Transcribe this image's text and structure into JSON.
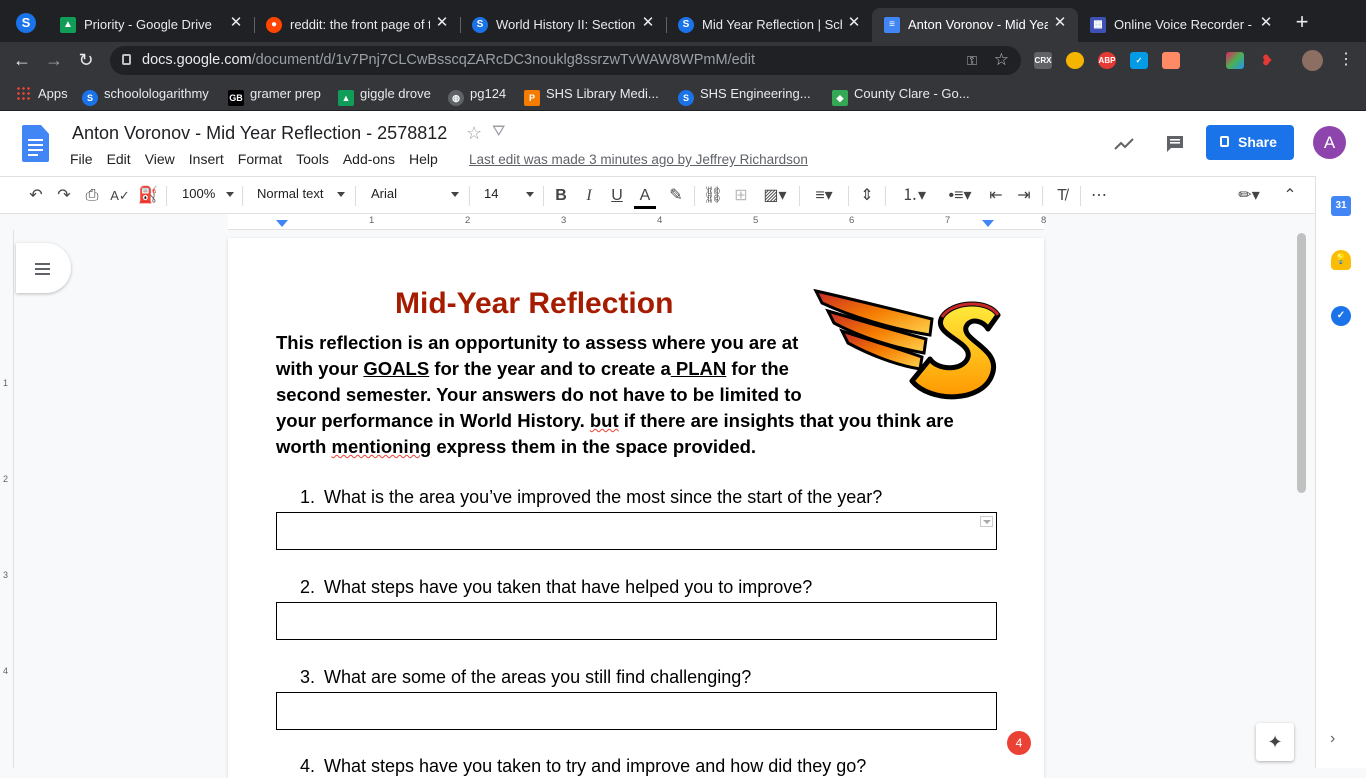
{
  "browser": {
    "tabs": [
      {
        "title": "Priority - Google Drive",
        "icon": "google-drive-icon",
        "active": false
      },
      {
        "title": "reddit: the front page of t",
        "icon": "reddit-icon",
        "active": false
      },
      {
        "title": "World History II: Section",
        "icon": "schoology-icon",
        "active": false
      },
      {
        "title": "Mid Year Reflection | Sch",
        "icon": "schoology-icon",
        "active": false
      },
      {
        "title": "Anton Voronov - Mid Yea",
        "icon": "google-docs-icon",
        "active": true
      },
      {
        "title": "Online Voice Recorder - I",
        "icon": "voice-recorder-icon",
        "active": false
      }
    ],
    "url_host": "docs.google.com",
    "url_path": "/document/d/1v7Pnj7CLCwBsscqZARcDC3nouklg8ssrzwTvWAW8WPmM/edit",
    "extensions": [
      {
        "name": "crx-icon",
        "label": "CRX"
      },
      {
        "name": "owl-icon",
        "label": ""
      },
      {
        "name": "adblock-icon",
        "label": "ABP"
      },
      {
        "name": "checkbox-ext-icon",
        "label": ""
      },
      {
        "name": "package-ext-icon",
        "label": ""
      },
      {
        "name": "rainbow-ext-icon",
        "label": ""
      },
      {
        "name": "red-ext-icon",
        "label": ""
      }
    ]
  },
  "bookmarks": [
    {
      "label": "Apps",
      "icon": "apps-grid-icon"
    },
    {
      "label": "schoolologarithmy",
      "icon": "schoology-icon"
    },
    {
      "label": "gramer prep",
      "icon": "gb-icon"
    },
    {
      "label": "giggle drove",
      "icon": "google-drive-icon"
    },
    {
      "label": "pg124",
      "icon": "globe-icon"
    },
    {
      "label": "SHS Library Medi...",
      "icon": "library-icon"
    },
    {
      "label": "SHS Engineering...",
      "icon": "schoology-icon"
    },
    {
      "label": "County Clare - Go...",
      "icon": "maps-icon"
    }
  ],
  "docs": {
    "title": "Anton Voronov - Mid Year Reflection - 2578812",
    "menu": [
      "File",
      "Edit",
      "View",
      "Insert",
      "Format",
      "Tools",
      "Add-ons",
      "Help"
    ],
    "last_edit": "Last edit was made 3 minutes ago by Jeffrey Richardson",
    "share_label": "Share",
    "avatar_letter": "A",
    "toolbar": {
      "zoom": "100%",
      "style": "Normal text",
      "font": "Arial",
      "size": "14"
    },
    "ruler_numbers": [
      "1",
      "2",
      "3",
      "4",
      "5",
      "6",
      "7",
      "8"
    ],
    "left_ruler_numbers": [
      "1",
      "2",
      "3",
      "4"
    ],
    "notification_count": "4",
    "side_panel": [
      "calendar-icon",
      "keep-icon",
      "tasks-icon"
    ]
  },
  "document": {
    "heading": "Mid-Year Reflection",
    "intro": {
      "l1": "This reflection is an opportunity to assess where you are at",
      "l2a": "with your ",
      "goals": "GOALS",
      "l2b": " for the year and to create a",
      "plan": " PLAN",
      "l2c": " for the",
      "l3": "second semester. Your answers do not have to be limited to",
      "l4a": "your performance in World History. ",
      "but": "but",
      "l4b": " if there are insights that you think are",
      "l5a": "worth ",
      "mentioning": "mentioning",
      "l5b": " express them in the space provided."
    },
    "questions": [
      {
        "num": "1.",
        "text": "What is the area you’ve improved the most since the start of the year?"
      },
      {
        "num": "2.",
        "text": "What steps have you taken that have helped you to improve?"
      },
      {
        "num": "3.",
        "text": "What are some of the areas you still find challenging?"
      },
      {
        "num": "4.",
        "text": "What steps have you taken to try and improve and how did they go?"
      }
    ],
    "logo_letter": "S"
  }
}
